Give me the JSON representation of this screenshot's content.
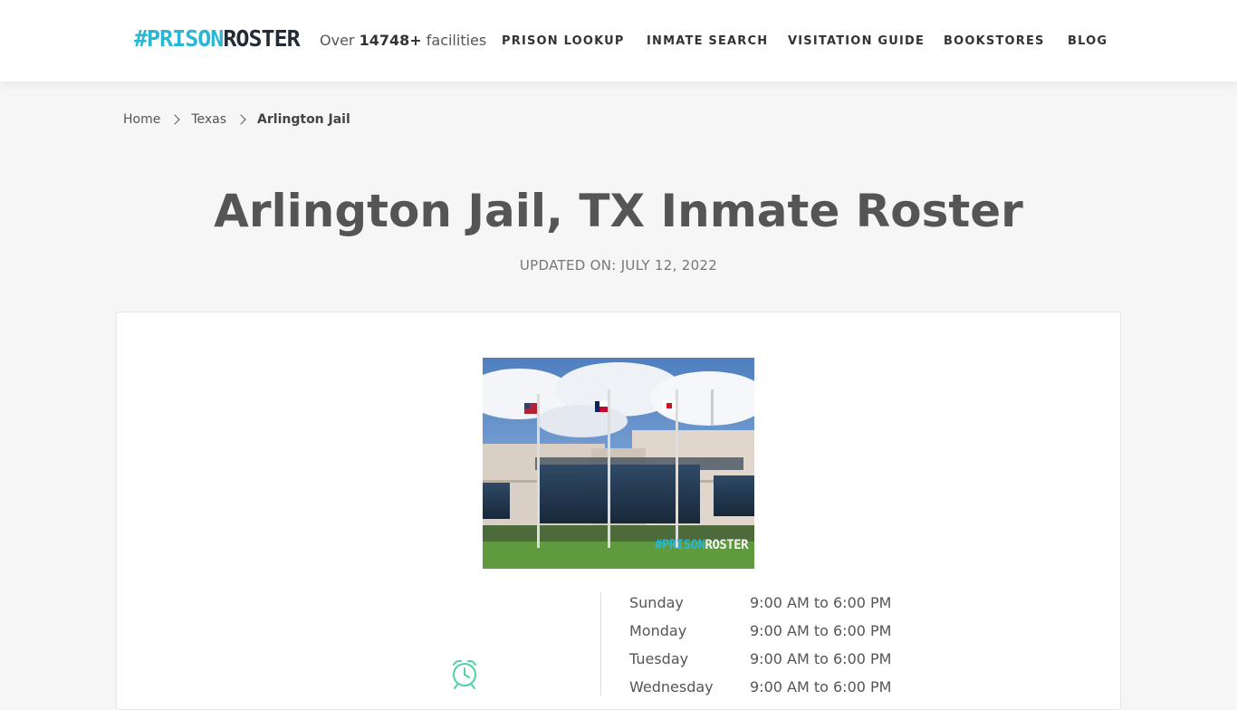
{
  "header": {
    "logo_hash": "#PRISON",
    "logo_roster": "ROSTER",
    "facilities_prefix": "Over",
    "facilities_count": "14748+",
    "facilities_suffix": "facilities",
    "nav": [
      "PRISON LOOKUP",
      "INMATE SEARCH",
      "VISITATION GUIDE",
      "BOOKSTORES",
      "BLOG"
    ]
  },
  "breadcrumb": {
    "home": "Home",
    "state": "Texas",
    "current": "Arlington Jail"
  },
  "page": {
    "title": "Arlington Jail, TX Inmate Roster",
    "updated": "UPDATED ON: JULY 12, 2022"
  },
  "photo": {
    "watermark_hash": "#PRISON",
    "watermark_roster": "ROSTER"
  },
  "hours": [
    {
      "day": "Sunday",
      "time": "9:00 AM to 6:00 PM"
    },
    {
      "day": "Monday",
      "time": "9:00 AM to 6:00 PM"
    },
    {
      "day": "Tuesday",
      "time": "9:00 AM to 6:00 PM"
    },
    {
      "day": "Wednesday",
      "time": "9:00 AM to 6:00 PM"
    }
  ],
  "icons": {
    "hours": "alarm-clock-icon",
    "breadcrumb_separator": "chevron-right-icon"
  },
  "colors": {
    "brand_cyan": "#29b7d3",
    "brand_dark": "#222b36",
    "clock_green": "#4fd1a0"
  }
}
